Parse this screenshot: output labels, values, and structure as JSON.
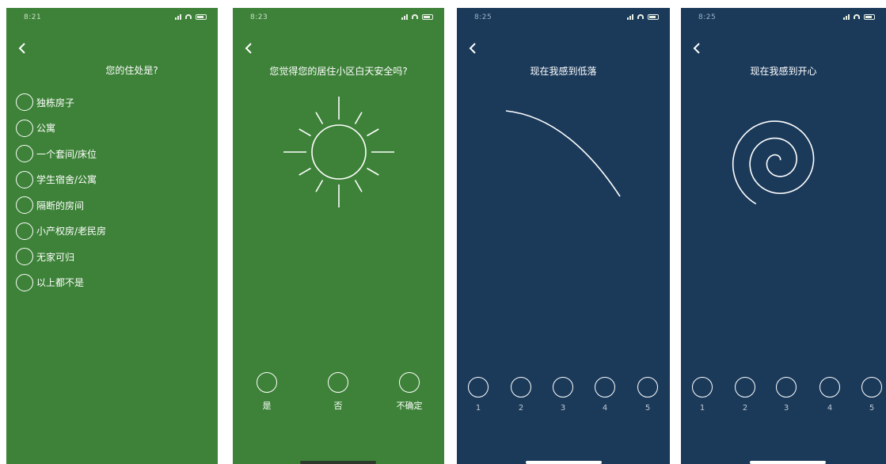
{
  "screens": [
    {
      "status_time": "8:21",
      "title": "您的住处是?",
      "options": [
        "独栋房子",
        "公寓",
        "一个套间/床位",
        "学生宿舍/公寓",
        "隔断的房间",
        "小产权房/老民房",
        "无家可归",
        "以上都不是"
      ]
    },
    {
      "status_time": "8:23",
      "title": "您觉得您的居住小区白天安全吗?",
      "illustration": "sun-icon",
      "choices": [
        "是",
        "否",
        "不确定"
      ]
    },
    {
      "status_time": "8:25",
      "title": "现在我感到低落",
      "illustration": "descending-curve-icon",
      "scale": [
        "1",
        "2",
        "3",
        "4",
        "5"
      ]
    },
    {
      "status_time": "8:25",
      "title": "现在我感到开心",
      "illustration": "spiral-icon",
      "scale": [
        "1",
        "2",
        "3",
        "4",
        "5"
      ]
    }
  ],
  "colors": {
    "green_bg": "#3d8238",
    "navy_bg": "#1b3a5a",
    "foreground": "#ffffff"
  }
}
